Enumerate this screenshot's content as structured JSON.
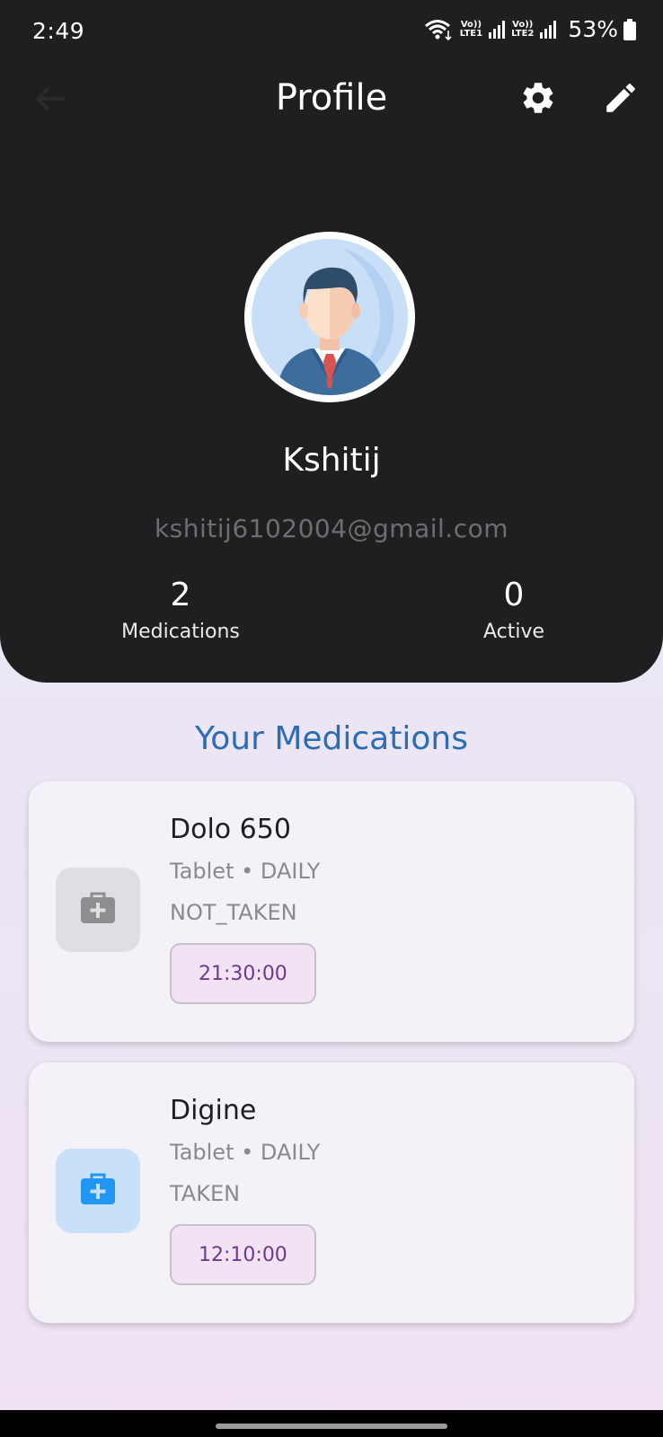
{
  "status_bar": {
    "time": "2:49",
    "lte1": "LTE1",
    "lte2": "LTE2",
    "vo1": "Vo))",
    "vo2": "Vo))",
    "battery": "53%",
    "icons": [
      "wifi-icon",
      "signal-icon",
      "battery-icon"
    ]
  },
  "topbar": {
    "title": "Profile",
    "icons": [
      "back-arrow-icon",
      "settings-gear-icon",
      "edit-pencil-icon"
    ]
  },
  "profile": {
    "name": "Kshitij",
    "email": "kshitij6102004@gmail.com",
    "stats": [
      {
        "value": "2",
        "label": "Medications"
      },
      {
        "value": "0",
        "label": "Active"
      }
    ]
  },
  "medications": {
    "title": "Your Medications",
    "items": [
      {
        "name": "Dolo 650",
        "type": "Tablet • DAILY",
        "status": "NOT_TAKEN",
        "time": "21:30:00",
        "icon": "medical-kit-icon",
        "icon_color": "#8e8e90"
      },
      {
        "name": "Digine",
        "type": "Tablet • DAILY",
        "status": "TAKEN",
        "time": "12:10:00",
        "icon": "medical-kit-icon",
        "icon_color": "#2196f3"
      }
    ]
  },
  "colors": {
    "header_bg": "#1f1f21",
    "accent": "#2a6cb5",
    "chip_text": "#6e3a8c"
  }
}
